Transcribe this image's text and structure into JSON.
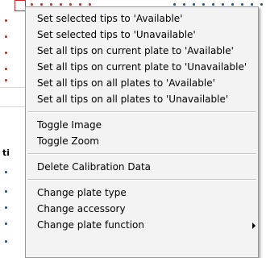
{
  "menu": {
    "groups": [
      [
        {
          "label": "Set selected tips to 'Available'"
        },
        {
          "label": "Set selected tips to 'Unavailable'"
        },
        {
          "label": "Set all tips on current plate to 'Available'"
        },
        {
          "label": "Set all tips on current plate to 'Unavailable'"
        },
        {
          "label": "Set all tips on all plates to 'Available'"
        },
        {
          "label": "Set all tips on all plates to 'Unavailable'"
        }
      ],
      [
        {
          "label": "Toggle Image"
        },
        {
          "label": "Toggle Zoom"
        }
      ],
      [
        {
          "label": "Delete Calibration Data"
        }
      ],
      [
        {
          "label": "Change plate type"
        },
        {
          "label": "Change accessory"
        },
        {
          "label": "Change plate function",
          "submenu": true
        }
      ]
    ]
  },
  "background": {
    "partial_label": "ti"
  },
  "colors": {
    "menu_bg": "#f3f3f3",
    "menu_border": "#979797",
    "separator": "#c8c8c8",
    "text": "#000000",
    "selection_box": "#cc2a2a",
    "tip_red": "#b83030",
    "tip_blue": "#244a86"
  }
}
